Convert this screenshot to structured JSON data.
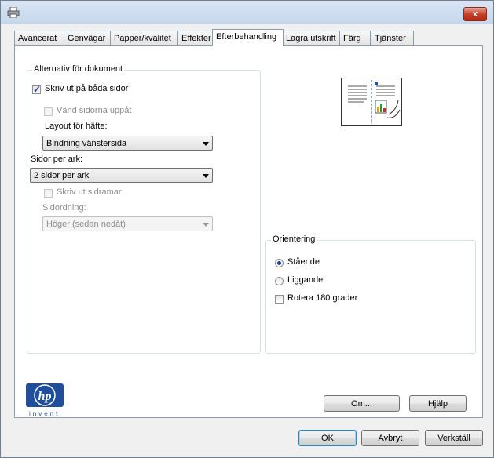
{
  "window": {
    "close_glyph": "x",
    "app_icon": "printer-icon"
  },
  "tabs": [
    {
      "label": "Avancerat"
    },
    {
      "label": "Genvägar"
    },
    {
      "label": "Papper/kvalitet"
    },
    {
      "label": "Effekter"
    },
    {
      "label": "Efterbehandling"
    },
    {
      "label": "Lagra utskrift"
    },
    {
      "label": "Färg"
    },
    {
      "label": "Tjänster"
    }
  ],
  "active_tab": "Efterbehandling",
  "document_options": {
    "title": "Alternativ för dokument",
    "duplex_label": "Skriv ut på båda sidor",
    "duplex_checked": true,
    "flip_label": "Vänd sidorna uppåt",
    "flip_checked": false,
    "booklet_label": "Layout för häfte:",
    "booklet_value": "Bindning vänstersida",
    "pages_per_sheet_label": "Sidor per ark:",
    "pages_per_sheet_value": "2 sidor per ark",
    "borders_label": "Skriv ut sidramar",
    "borders_checked": false,
    "page_order_label": "Sidordning:",
    "page_order_value": "Höger (sedan nedåt)"
  },
  "orientation": {
    "title": "Orientering",
    "portrait_label": "Stående",
    "landscape_label": "Liggande",
    "selected": "Stående",
    "rotate_label": "Rotera 180 grader",
    "rotate_checked": false
  },
  "logo": {
    "text": "invent",
    "icon": "hp-logo-icon"
  },
  "buttons": {
    "about": "Om...",
    "help": "Hjälp",
    "ok": "OK",
    "cancel": "Avbryt",
    "apply": "Verkställ"
  },
  "colors": {
    "accent": "#1c4796",
    "close": "#c8412a"
  }
}
